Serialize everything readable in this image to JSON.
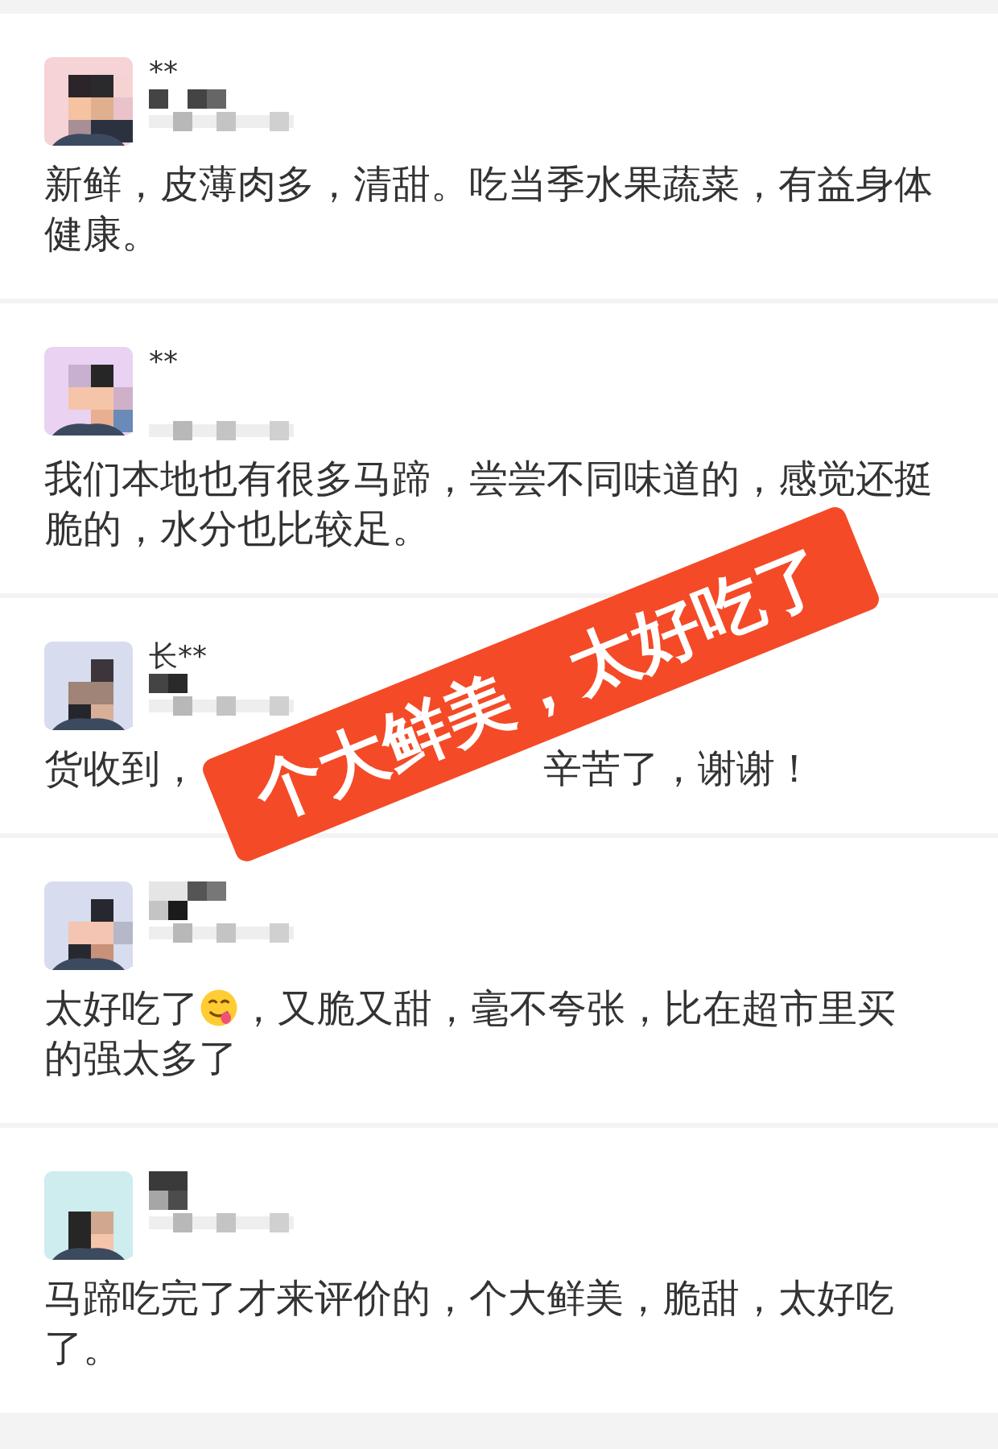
{
  "reviews": [
    {
      "name": "**",
      "parts": [
        {
          "kind": "text",
          "text": "新鲜，皮薄肉多，清甜。吃当季水果蔬菜，有益身体健康。"
        }
      ]
    },
    {
      "name": "**",
      "parts": [
        {
          "kind": "text",
          "text": "我们本地也有很多马蹄，尝尝不同味道的，感觉还挺脆的，水分也比较足。"
        }
      ]
    },
    {
      "name": "长**",
      "parts": [
        {
          "kind": "text",
          "text": "货收到，"
        },
        {
          "kind": "covered"
        },
        {
          "kind": "text",
          "text": "辛苦了，谢谢！"
        }
      ]
    },
    {
      "parts": [
        {
          "kind": "text",
          "text": "太好吃了"
        },
        {
          "kind": "emoji"
        },
        {
          "kind": "text",
          "text": "，又脆又甜，毫不夸张，比在超市里买"
        },
        {
          "kind": "text",
          "text": "的强太多了"
        }
      ]
    },
    {
      "parts": [
        {
          "kind": "text",
          "text": "马蹄吃完了才来评价的，个大鲜美，脆甜，太好吃了。"
        }
      ]
    }
  ],
  "banner": {
    "text": "个大鲜美，太好吃了"
  }
}
